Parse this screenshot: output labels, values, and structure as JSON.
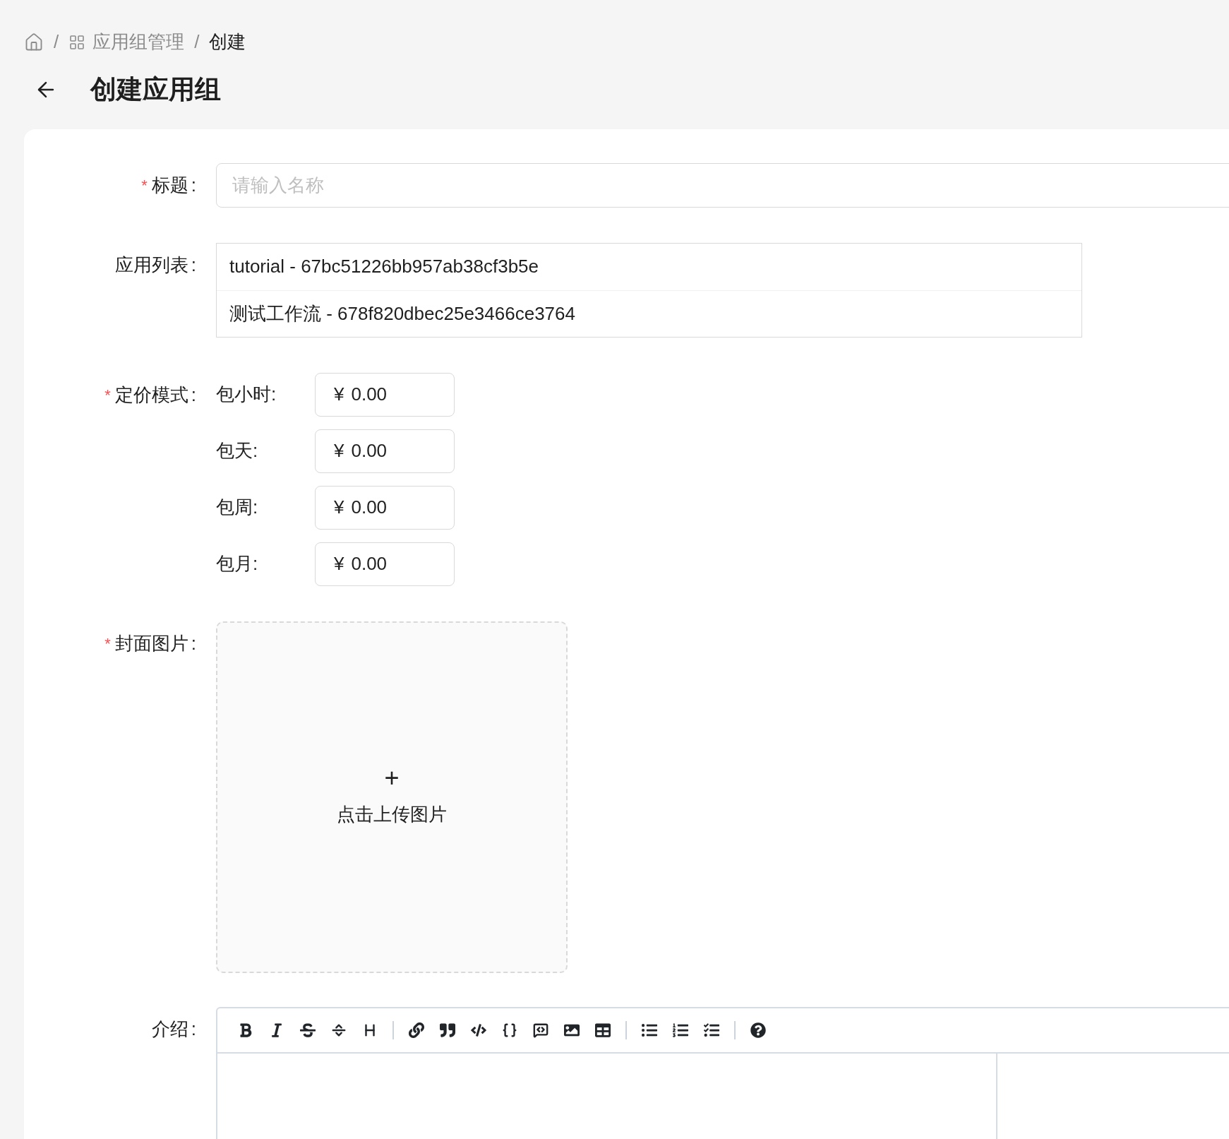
{
  "breadcrumb": [
    {
      "kind": "home"
    },
    {
      "kind": "apps",
      "separator": "/",
      "label": "应用组管理"
    },
    {
      "kind": "current",
      "separator": "/",
      "label": "创建"
    }
  ],
  "page_title": "创建应用组",
  "form": {
    "title": {
      "required_mark": "*",
      "label": "标题",
      "colon": ":",
      "placeholder": "请输入名称"
    },
    "app_list": {
      "label": "应用列表",
      "colon": ":",
      "items": [
        "tutorial - 67bc51226bb957ab38cf3b5e",
        "测试工作流 - 678f820dbec25e3466ce3764"
      ]
    },
    "pricing": {
      "required_mark": "*",
      "label": "定价模式",
      "colon": ":",
      "rows": [
        {
          "label": "包小时:",
          "currency": "¥",
          "value": "0.00"
        },
        {
          "label": "包天:",
          "currency": "¥",
          "value": "0.00"
        },
        {
          "label": "包周:",
          "currency": "¥",
          "value": "0.00"
        },
        {
          "label": "包月:",
          "currency": "¥",
          "value": "0.00"
        }
      ]
    },
    "cover": {
      "required_mark": "*",
      "label": "封面图片",
      "colon": ":",
      "plus": "+",
      "upload_text": "点击上传图片"
    },
    "intro": {
      "label": "介绍",
      "colon": ":"
    }
  }
}
